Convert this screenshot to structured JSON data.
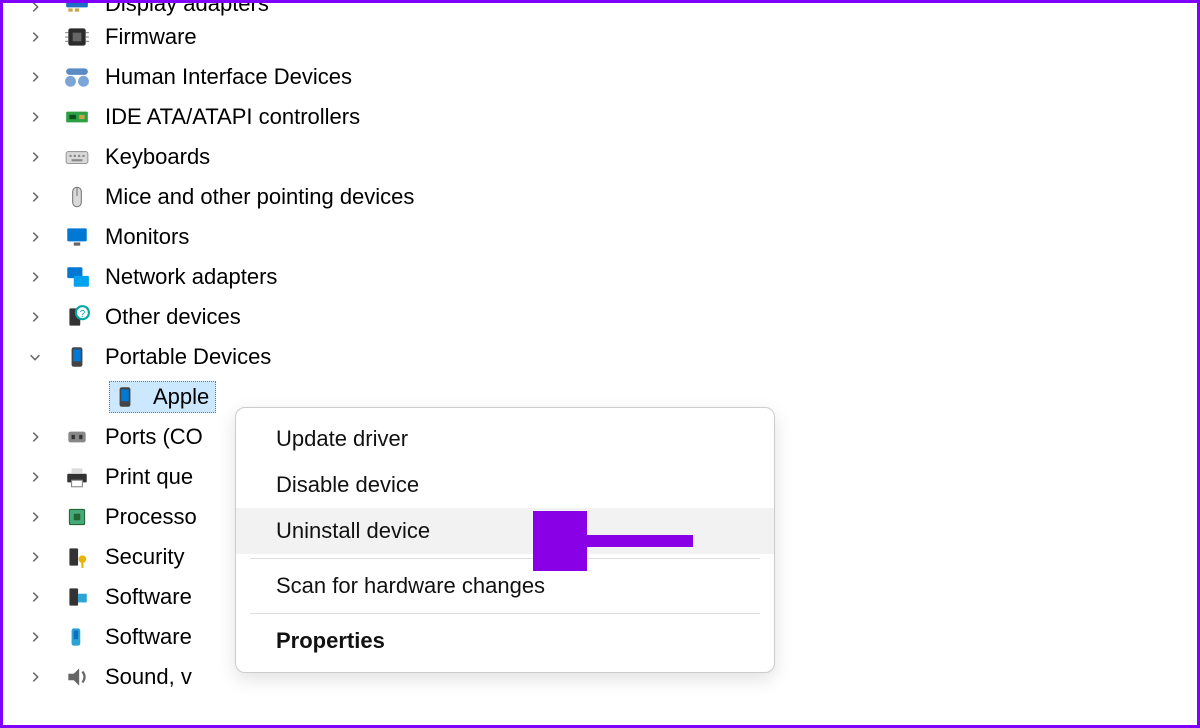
{
  "tree": {
    "items": [
      {
        "label": "Display adapters",
        "icon": "display-adapter",
        "expanded": false,
        "truncatedTop": true
      },
      {
        "label": "Firmware",
        "icon": "firmware",
        "expanded": false
      },
      {
        "label": "Human Interface Devices",
        "icon": "hid",
        "expanded": false
      },
      {
        "label": "IDE ATA/ATAPI controllers",
        "icon": "ide",
        "expanded": false
      },
      {
        "label": "Keyboards",
        "icon": "keyboard",
        "expanded": false
      },
      {
        "label": "Mice and other pointing devices",
        "icon": "mouse",
        "expanded": false
      },
      {
        "label": "Monitors",
        "icon": "monitor",
        "expanded": false
      },
      {
        "label": "Network adapters",
        "icon": "network",
        "expanded": false
      },
      {
        "label": "Other devices",
        "icon": "other",
        "expanded": false
      },
      {
        "label": "Portable Devices",
        "icon": "portable",
        "expanded": true,
        "children": [
          {
            "label": "Apple",
            "icon": "portable",
            "selected": true
          }
        ]
      },
      {
        "label": "Ports (CO",
        "icon": "ports",
        "expanded": false
      },
      {
        "label": "Print que",
        "icon": "printer",
        "expanded": false
      },
      {
        "label": "Processo",
        "icon": "processor",
        "expanded": false
      },
      {
        "label": "Security",
        "icon": "security",
        "expanded": false
      },
      {
        "label": "Software",
        "icon": "software1",
        "expanded": false
      },
      {
        "label": "Software",
        "icon": "software2",
        "expanded": false
      },
      {
        "label": "Sound, v",
        "icon": "sound",
        "expanded": false
      }
    ]
  },
  "context_menu": {
    "items": [
      {
        "label": "Update driver"
      },
      {
        "label": "Disable device"
      },
      {
        "label": "Uninstall device",
        "highlight": true
      },
      {
        "separator": true
      },
      {
        "label": "Scan for hardware changes"
      },
      {
        "separator": true
      },
      {
        "label": "Properties",
        "bold": true
      }
    ]
  }
}
